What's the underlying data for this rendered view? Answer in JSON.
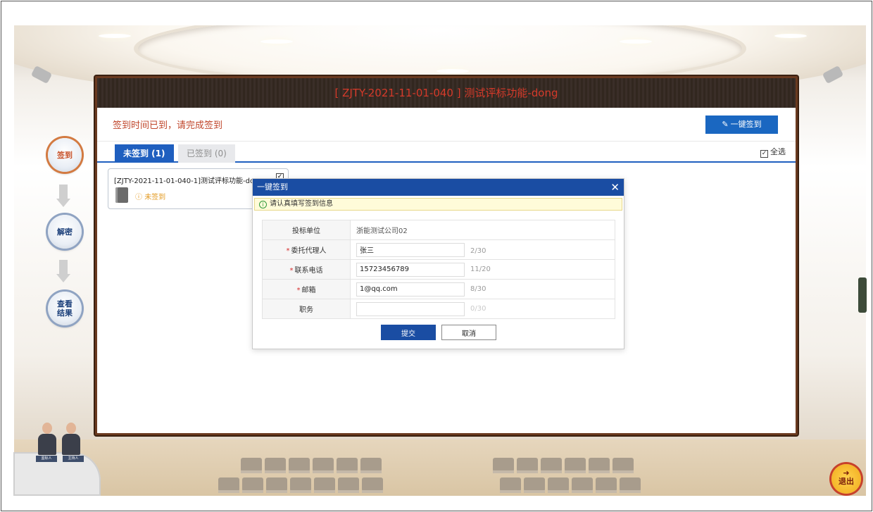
{
  "screen": {
    "title": "[ ZJTY-2021-11-01-040 ] 测试评标功能-dong",
    "notice": "签到时间已到，请完成签到",
    "one_key_signin_label": "一键签到",
    "tabs": [
      {
        "label": "未签到 (1)",
        "active": true
      },
      {
        "label": "已签到 (0)",
        "active": false
      }
    ],
    "select_all_label": "全选",
    "cards": [
      {
        "title": "[ZJTY-2021-11-01-040-1]测试评标功能-dong",
        "status": "未签到",
        "checked": true
      }
    ]
  },
  "nav": {
    "steps": [
      {
        "label": "签到",
        "active": true
      },
      {
        "label": "解密",
        "active": false
      },
      {
        "label": "查看 结果",
        "active": false
      }
    ],
    "exit_label": "退出"
  },
  "desk": {
    "labels": [
      "监标人",
      "主持人"
    ]
  },
  "modal": {
    "title": "一键签到",
    "close_glyph": "✕",
    "tip": "请认真填写签到信息",
    "fields": [
      {
        "label": "投标单位",
        "required": false,
        "value": "浙能测试公司02",
        "editable": false,
        "count": ""
      },
      {
        "label": "委托代理人",
        "required": true,
        "value": "张三",
        "editable": true,
        "count": "2/30"
      },
      {
        "label": "联系电话",
        "required": true,
        "value": "15723456789",
        "editable": true,
        "count": "11/20"
      },
      {
        "label": "邮箱",
        "required": true,
        "value": "1@qq.com",
        "editable": true,
        "count": "8/30"
      },
      {
        "label": "职务",
        "required": false,
        "value": "",
        "editable": true,
        "count": "0/30"
      }
    ],
    "submit_label": "提交",
    "cancel_label": "取消"
  },
  "colors": {
    "primary_blue": "#1a4da3",
    "tab_blue": "#1f5fbf",
    "notice_red": "#c0462b",
    "title_red": "#d53a2a",
    "status_orange": "#e39a21"
  }
}
